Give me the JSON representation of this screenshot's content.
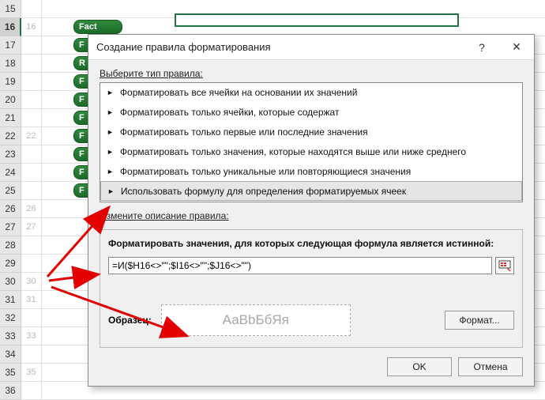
{
  "rows": {
    "outer": [
      "15",
      "16",
      "17",
      "18",
      "19",
      "20",
      "21",
      "22",
      "23",
      "24",
      "25",
      "26",
      "27",
      "28",
      "29",
      "30",
      "31",
      "32",
      "33",
      "34",
      "35",
      "36"
    ],
    "inner": [
      "",
      "16",
      "",
      "",
      "",
      "",
      "",
      "22",
      "",
      "",
      "",
      "26",
      "27",
      "",
      "",
      "30",
      "31",
      "",
      "33",
      "",
      "35",
      ""
    ]
  },
  "pills": {
    "fact": "Fact",
    "partial": [
      "F",
      "R",
      "F",
      "F",
      "F",
      "F",
      "F",
      "F",
      "F"
    ]
  },
  "dialog": {
    "title": "Создание правила форматирования",
    "help": "?",
    "close": "✕",
    "select_label": "Выберите тип правила:",
    "rules": [
      "Форматировать все ячейки на основании их значений",
      "Форматировать только ячейки, которые содержат",
      "Форматировать только первые или последние значения",
      "Форматировать только значения, которые находятся выше или ниже среднего",
      "Форматировать только уникальные или повторяющиеся значения",
      "Использовать формулу для определения форматируемых ячеек"
    ],
    "edit_label": "Измените описание правила:",
    "formula_caption": "Форматировать значения, для которых следующая формула является истинной:",
    "formula_value": "=И($H16<>\"\";$I16<>\"\";$J16<>\"\")",
    "preview_label": "Образец:",
    "preview_text": "АаВbБбЯя",
    "format_btn": "Формат...",
    "ok": "OK",
    "cancel": "Отмена"
  }
}
